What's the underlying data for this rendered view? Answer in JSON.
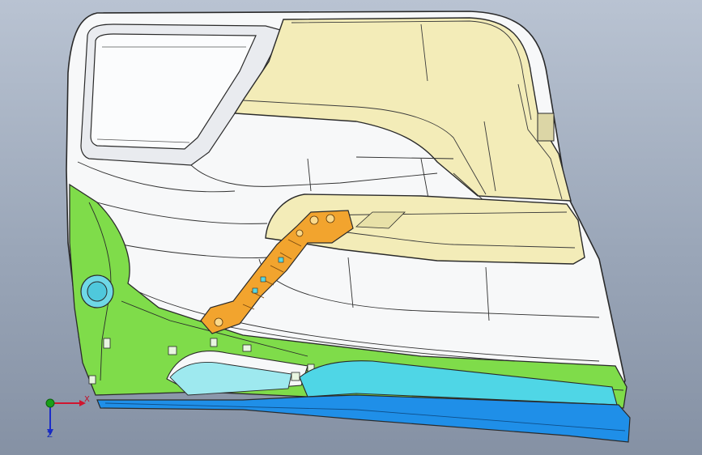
{
  "viewport": {
    "background_top": "#b9c3d2",
    "background_bottom": "#8591a4"
  },
  "model": {
    "type": "car door trim panel (CAD model)",
    "colors": {
      "upper_insert": "#f3ecb8",
      "body_white": "#f7f8f9",
      "lower_map_pocket": "#7fdc4a",
      "bracket": "#f2a42e",
      "kick_strip_cyan": "#4fd6e6",
      "kick_strip_blue": "#1f8fe8",
      "edge_lines": "#2a2a2a"
    }
  },
  "triad": {
    "x_label": "X",
    "z_label": "Z",
    "x_color": "#d0152f",
    "y_color": "#18a018",
    "z_color": "#1b2cc9",
    "icons": [
      "x-axis-arrow",
      "y-axis-dot",
      "z-axis-arrow"
    ]
  }
}
